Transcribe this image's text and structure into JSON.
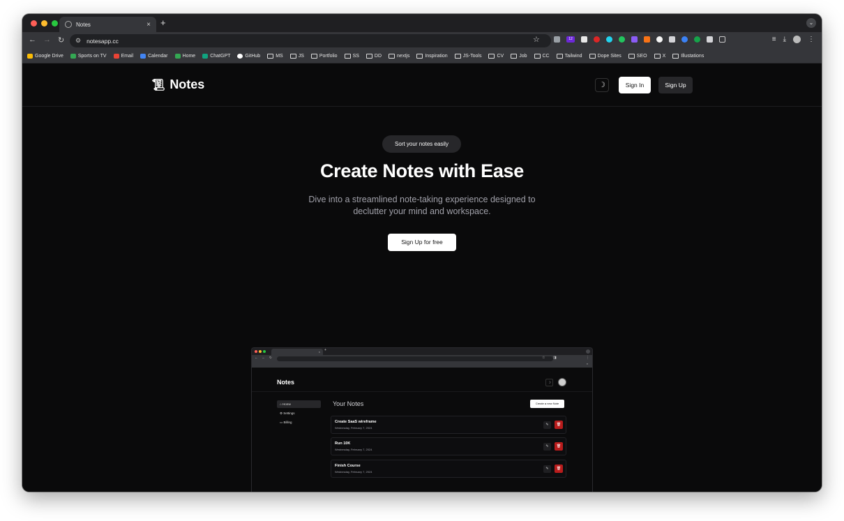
{
  "browser": {
    "tab_title": "Notes",
    "tab_close": "×",
    "new_tab": "+",
    "url": "notesapp.cc",
    "bookmarks": [
      "Google Drive",
      "Sports on TV",
      "Email",
      "Calendar",
      "Home",
      "ChatGPT",
      "GitHub",
      "MS",
      "JS",
      "Portfolio",
      "SS",
      "DD",
      "nextjs",
      "Inspiration",
      "JS-Tools",
      "CV",
      "Job",
      "CC",
      "Tailwind",
      "Dope Sites",
      "SEO",
      "X",
      "Illustations"
    ],
    "extension_badge": "12"
  },
  "header": {
    "logo_text": "Notes",
    "signin_label": "Sign In",
    "signup_label": "Sign Up"
  },
  "hero": {
    "pill": "Sort your notes easily",
    "title": "Create Notes with Ease",
    "subtitle": "Dive into a streamlined note-taking experience designed to declutter your mind and workspace.",
    "cta": "Sign Up for free"
  },
  "mockup": {
    "logo": "Notes",
    "nav": [
      "Home",
      "Settings",
      "Billing"
    ],
    "section_title": "Your Notes",
    "create_button": "Create a new Note",
    "notes": [
      {
        "title": "Create SaaS wireframe",
        "date": "Wednesday, February 7, 2024"
      },
      {
        "title": "Run 10K",
        "date": "Wednesday, February 7, 2024"
      },
      {
        "title": "Finish Course",
        "date": "Wednesday, February 7, 2024"
      }
    ]
  },
  "colors": {
    "page_bg": "#0a0a0b",
    "muted_text": "#a1a1aa",
    "delete_red": "#b91c1c"
  }
}
